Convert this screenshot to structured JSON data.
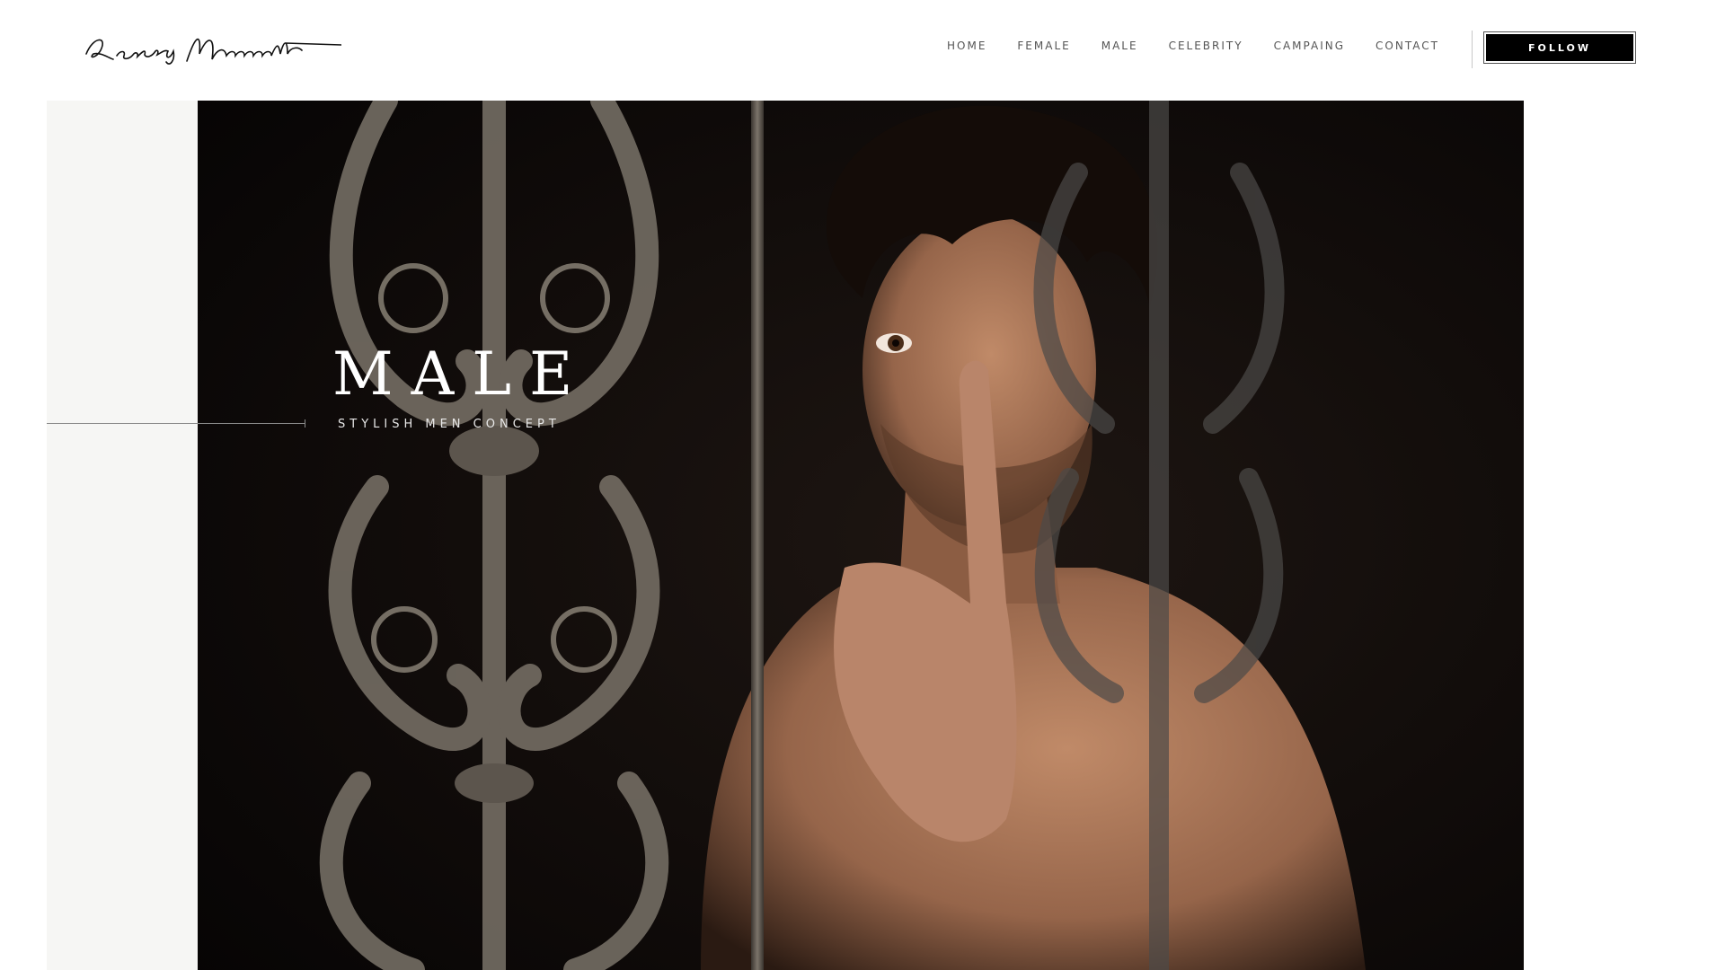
{
  "header": {
    "logo_text": "Rodrigo Marconatto",
    "nav": [
      {
        "label": "HOME"
      },
      {
        "label": "FEMALE"
      },
      {
        "label": "MALE"
      },
      {
        "label": "CELEBRITY"
      },
      {
        "label": "CAMPAING"
      },
      {
        "label": "CONTACT"
      }
    ],
    "follow_label": "FOLLOW"
  },
  "hero": {
    "title": "MALE",
    "subtitle": "STYLISH MEN CONCEPT",
    "image_alt": "Man behind ornate iron railing, finger to lips"
  },
  "colors": {
    "background": "#ffffff",
    "panel": "#f6f6f4",
    "button": "#000000",
    "hero_dark": "#0b0807",
    "skin": "#a9785a"
  }
}
